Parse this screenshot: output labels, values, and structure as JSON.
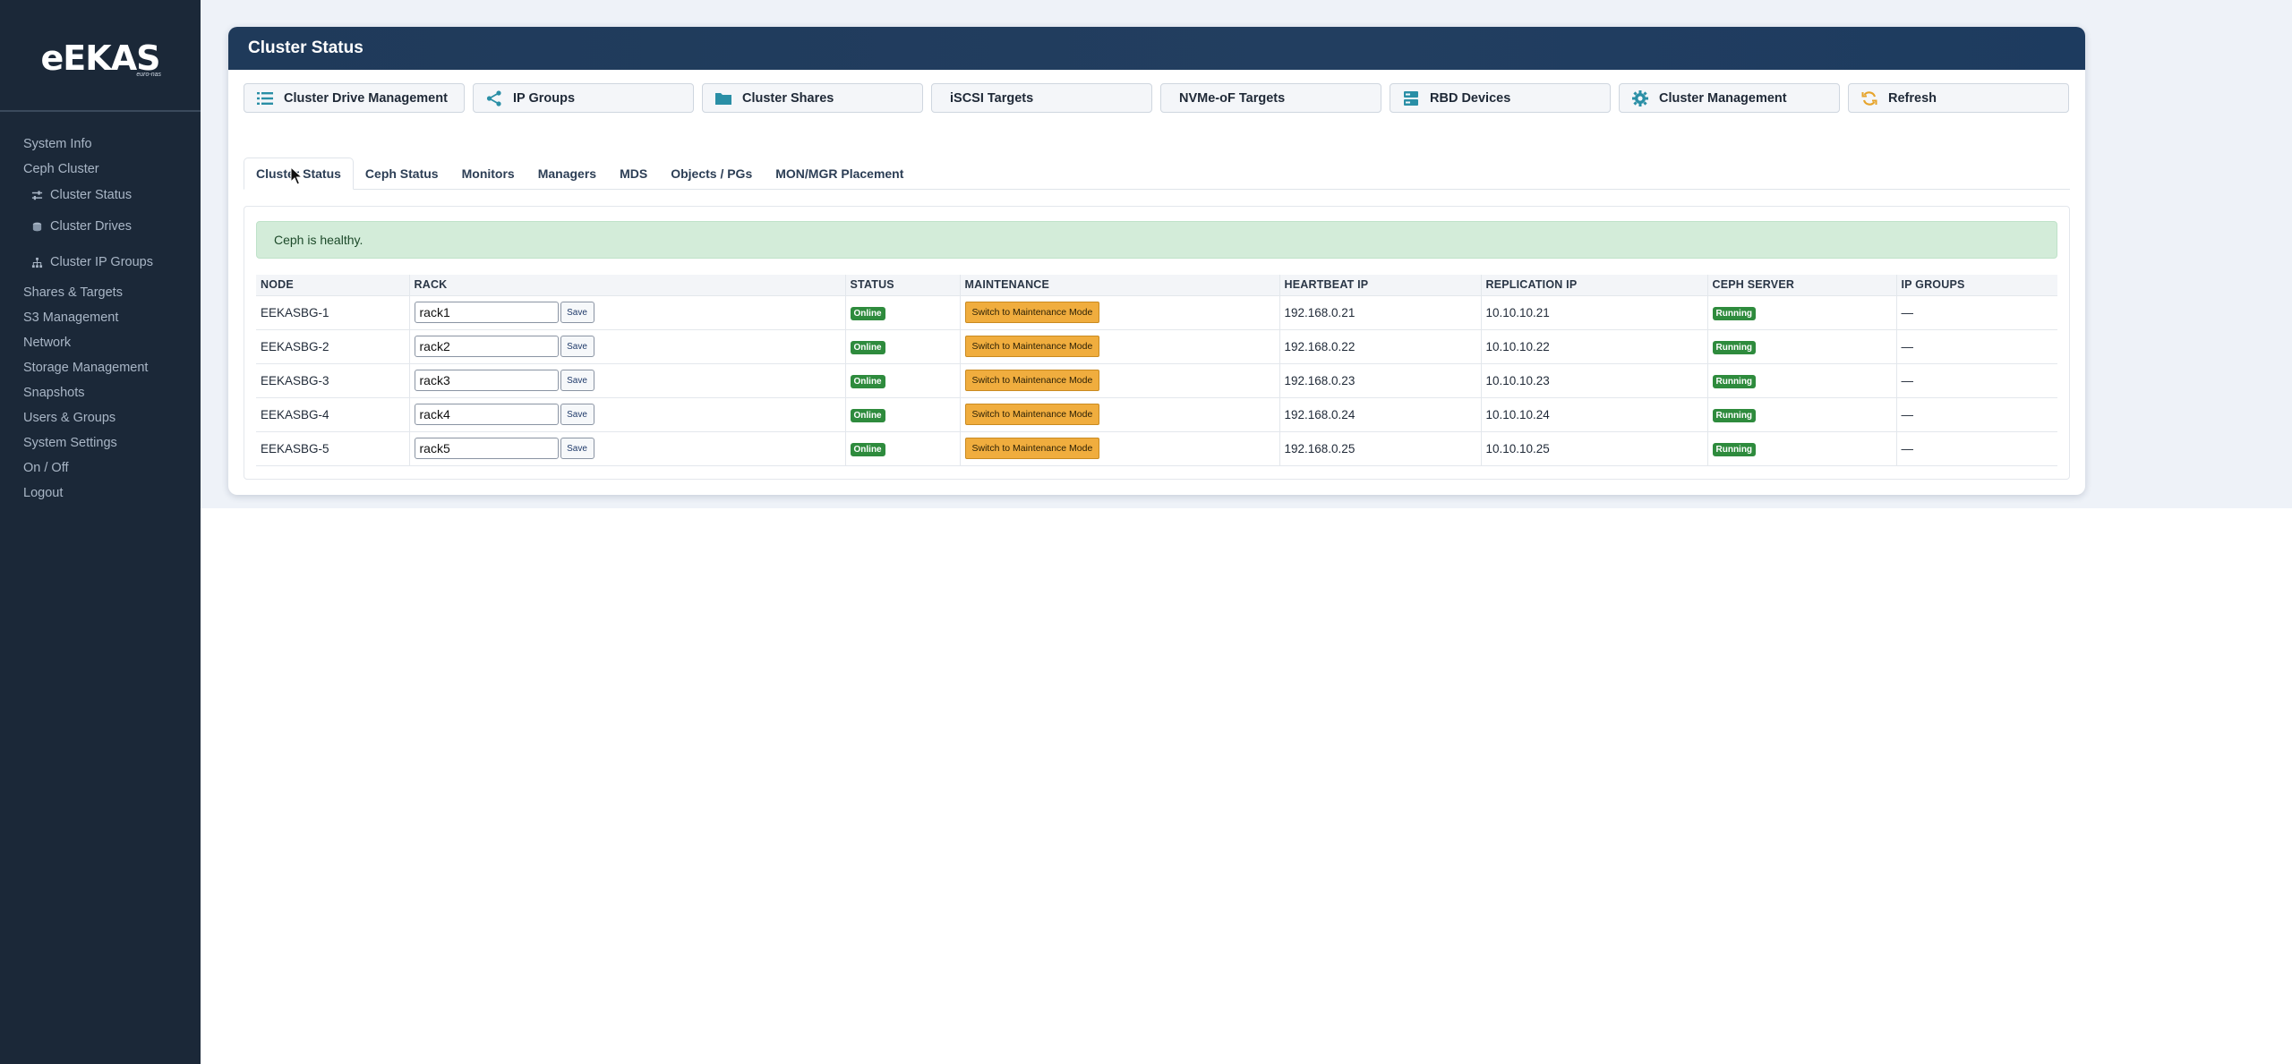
{
  "brand": {
    "logo": "eEKAS",
    "logo_sub": "euro-nas"
  },
  "sidebar": {
    "items": [
      {
        "label": "System Info",
        "type": "section"
      },
      {
        "label": "Ceph Cluster",
        "type": "section"
      },
      {
        "label": "Cluster Status",
        "type": "sub",
        "icon": "sliders-icon"
      },
      {
        "label": "Cluster Drives",
        "type": "sub",
        "icon": "drive-icon"
      },
      {
        "label": "Cluster IP Groups",
        "type": "sub",
        "icon": "sitemap-icon"
      },
      {
        "label": "Shares & Targets",
        "type": "section"
      },
      {
        "label": "S3 Management",
        "type": "section"
      },
      {
        "label": "Network",
        "type": "section"
      },
      {
        "label": "Storage Management",
        "type": "section"
      },
      {
        "label": "Snapshots",
        "type": "section"
      },
      {
        "label": "Users & Groups",
        "type": "section"
      },
      {
        "label": "System Settings",
        "type": "section"
      },
      {
        "label": "On / Off",
        "type": "section"
      },
      {
        "label": "Logout",
        "type": "section"
      }
    ]
  },
  "card": {
    "title": "Cluster Status"
  },
  "actions": [
    {
      "label": "Cluster Drive Management",
      "icon": "list-icon"
    },
    {
      "label": "IP Groups",
      "icon": "share-icon"
    },
    {
      "label": "Cluster Shares",
      "icon": "folder-icon"
    },
    {
      "label": "iSCSI Targets",
      "icon": ""
    },
    {
      "label": "NVMe-oF Targets",
      "icon": ""
    },
    {
      "label": "RBD Devices",
      "icon": "server-icon"
    },
    {
      "label": "Cluster Management",
      "icon": "gear-icon"
    },
    {
      "label": "Refresh",
      "icon": "refresh-icon"
    }
  ],
  "tabs": [
    {
      "label": "Cluster Status",
      "active": true
    },
    {
      "label": "Ceph Status"
    },
    {
      "label": "Monitors"
    },
    {
      "label": "Managers"
    },
    {
      "label": "MDS"
    },
    {
      "label": "Objects / PGs"
    },
    {
      "label": "MON/MGR Placement"
    }
  ],
  "alert": {
    "text": "Ceph is healthy."
  },
  "table": {
    "headers": [
      "NODE",
      "RACK",
      "STATUS",
      "MAINTENANCE",
      "HEARTBEAT IP",
      "REPLICATION IP",
      "CEPH SERVER",
      "IP GROUPS"
    ],
    "save_label": "Save",
    "maintenance_label": "Switch to Maintenance Mode",
    "rows": [
      {
        "node": "EEKASBG-1",
        "rack": "rack1",
        "status": "Online",
        "heartbeat_ip": "192.168.0.21",
        "replication_ip": "10.10.10.21",
        "ceph_server": "Running",
        "ip_groups": "—"
      },
      {
        "node": "EEKASBG-2",
        "rack": "rack2",
        "status": "Online",
        "heartbeat_ip": "192.168.0.22",
        "replication_ip": "10.10.10.22",
        "ceph_server": "Running",
        "ip_groups": "—"
      },
      {
        "node": "EEKASBG-3",
        "rack": "rack3",
        "status": "Online",
        "heartbeat_ip": "192.168.0.23",
        "replication_ip": "10.10.10.23",
        "ceph_server": "Running",
        "ip_groups": "—"
      },
      {
        "node": "EEKASBG-4",
        "rack": "rack4",
        "status": "Online",
        "heartbeat_ip": "192.168.0.24",
        "replication_ip": "10.10.10.24",
        "ceph_server": "Running",
        "ip_groups": "—"
      },
      {
        "node": "EEKASBG-5",
        "rack": "rack5",
        "status": "Online",
        "heartbeat_ip": "192.168.0.25",
        "replication_ip": "10.10.10.25",
        "ceph_server": "Running",
        "ip_groups": "—"
      }
    ]
  },
  "colors": {
    "sidebar_bg": "#1b2838",
    "header_bg": "#1f3a5a",
    "accent_icon": "#2a8fa6",
    "online_badge": "#2e8b3d",
    "maintenance_button": "#f0ad3e",
    "alert_bg": "#d3ecd9"
  }
}
